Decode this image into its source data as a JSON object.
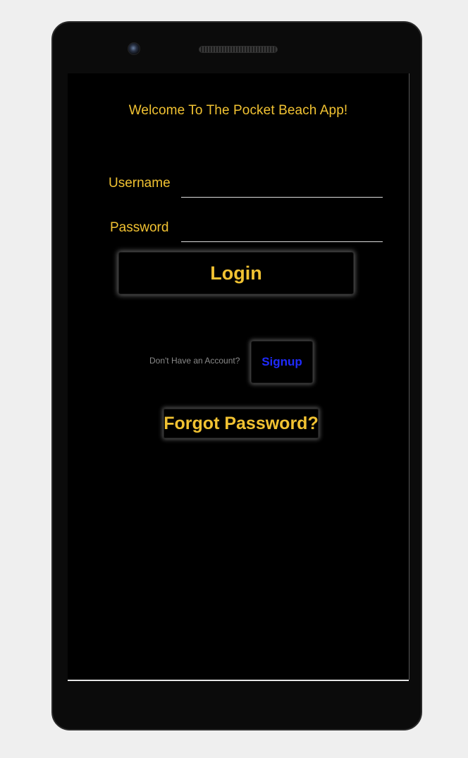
{
  "app": {
    "welcome_text": "Welcome To The Pocket Beach App!"
  },
  "login_form": {
    "username_label": "Username",
    "username_value": "",
    "password_label": "Password",
    "password_value": "",
    "login_button": "Login"
  },
  "signup_section": {
    "prompt": "Don't Have an Account?",
    "signup_button": "Signup"
  },
  "forgot_password_button": "Forgot Password?",
  "colors": {
    "accent": "#f1c232",
    "signup": "#1f2bff",
    "background": "#000000"
  }
}
